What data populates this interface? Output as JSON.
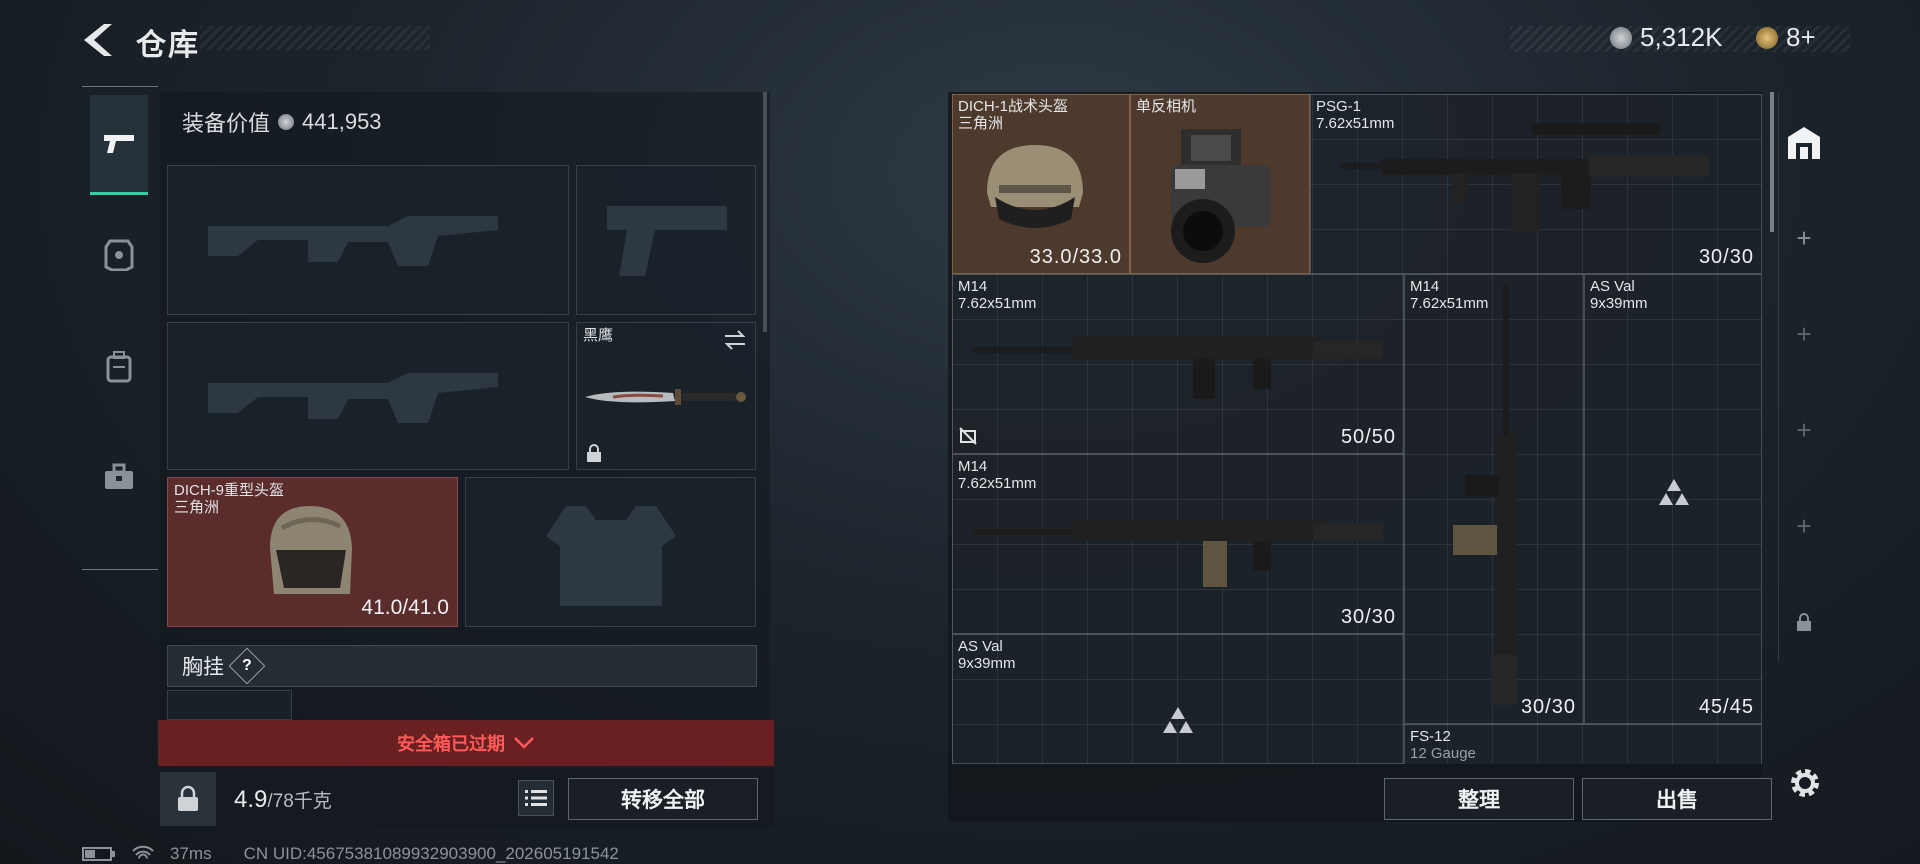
{
  "header": {
    "title": "仓库",
    "currency_main": "5,312K",
    "currency_second": "8+"
  },
  "loadout": {
    "equip_value_label": "装备价值",
    "equip_value": "441,953",
    "knife_name": "黑鹰",
    "helmet_name": "DICH-9重型头盔",
    "helmet_brand": "三角洲",
    "helmet_durability": "41.0/41.0",
    "chest_label": "胸挂",
    "chest_help": "?",
    "safe_box_status": "安全箱已过期",
    "weight_current": "4.9",
    "weight_max": "/78千克",
    "transfer_all": "转移全部"
  },
  "status_bar": {
    "ping": "37ms",
    "uid": "CN UID:4567538108993290390​0_202605191542"
  },
  "storage": {
    "items": [
      {
        "name": "DICH-1战术头盔",
        "sub": "三角洲",
        "count": "33.0/33.0"
      },
      {
        "name": "单反相机",
        "sub": "",
        "count": ""
      },
      {
        "name": "PSG-1",
        "sub": "7.62x51mm",
        "count": "30/30"
      },
      {
        "name": "M14",
        "sub": "7.62x51mm",
        "count": "50/50"
      },
      {
        "name": "M14",
        "sub": "7.62x51mm",
        "count": "30/30"
      },
      {
        "name": "AS Val",
        "sub": "9x39mm",
        "count": "45/45"
      },
      {
        "name": "M14",
        "sub": "7.62x51mm",
        "count": "30/30"
      },
      {
        "name": "AS Val",
        "sub": "9x39mm",
        "count": ""
      },
      {
        "name": "FS-12",
        "sub": "12 Gauge",
        "count": ""
      }
    ],
    "sort_label": "整理",
    "sell_label": "出售"
  },
  "colors": {
    "accent": "#2fd2a0",
    "expired_bg": "#6a2020",
    "expired_text": "#ff5a5a",
    "item_brown": "#4e3a2c",
    "item_red": "#5b2c2c"
  },
  "icons": {
    "tabs": [
      "pistol-icon",
      "armor-icon",
      "backpack-icon",
      "briefcase-icon"
    ],
    "right_tabs": [
      "warehouse-icon",
      "plus-icon",
      "plus-icon",
      "plus-icon",
      "plus-icon",
      "lock-icon"
    ]
  }
}
